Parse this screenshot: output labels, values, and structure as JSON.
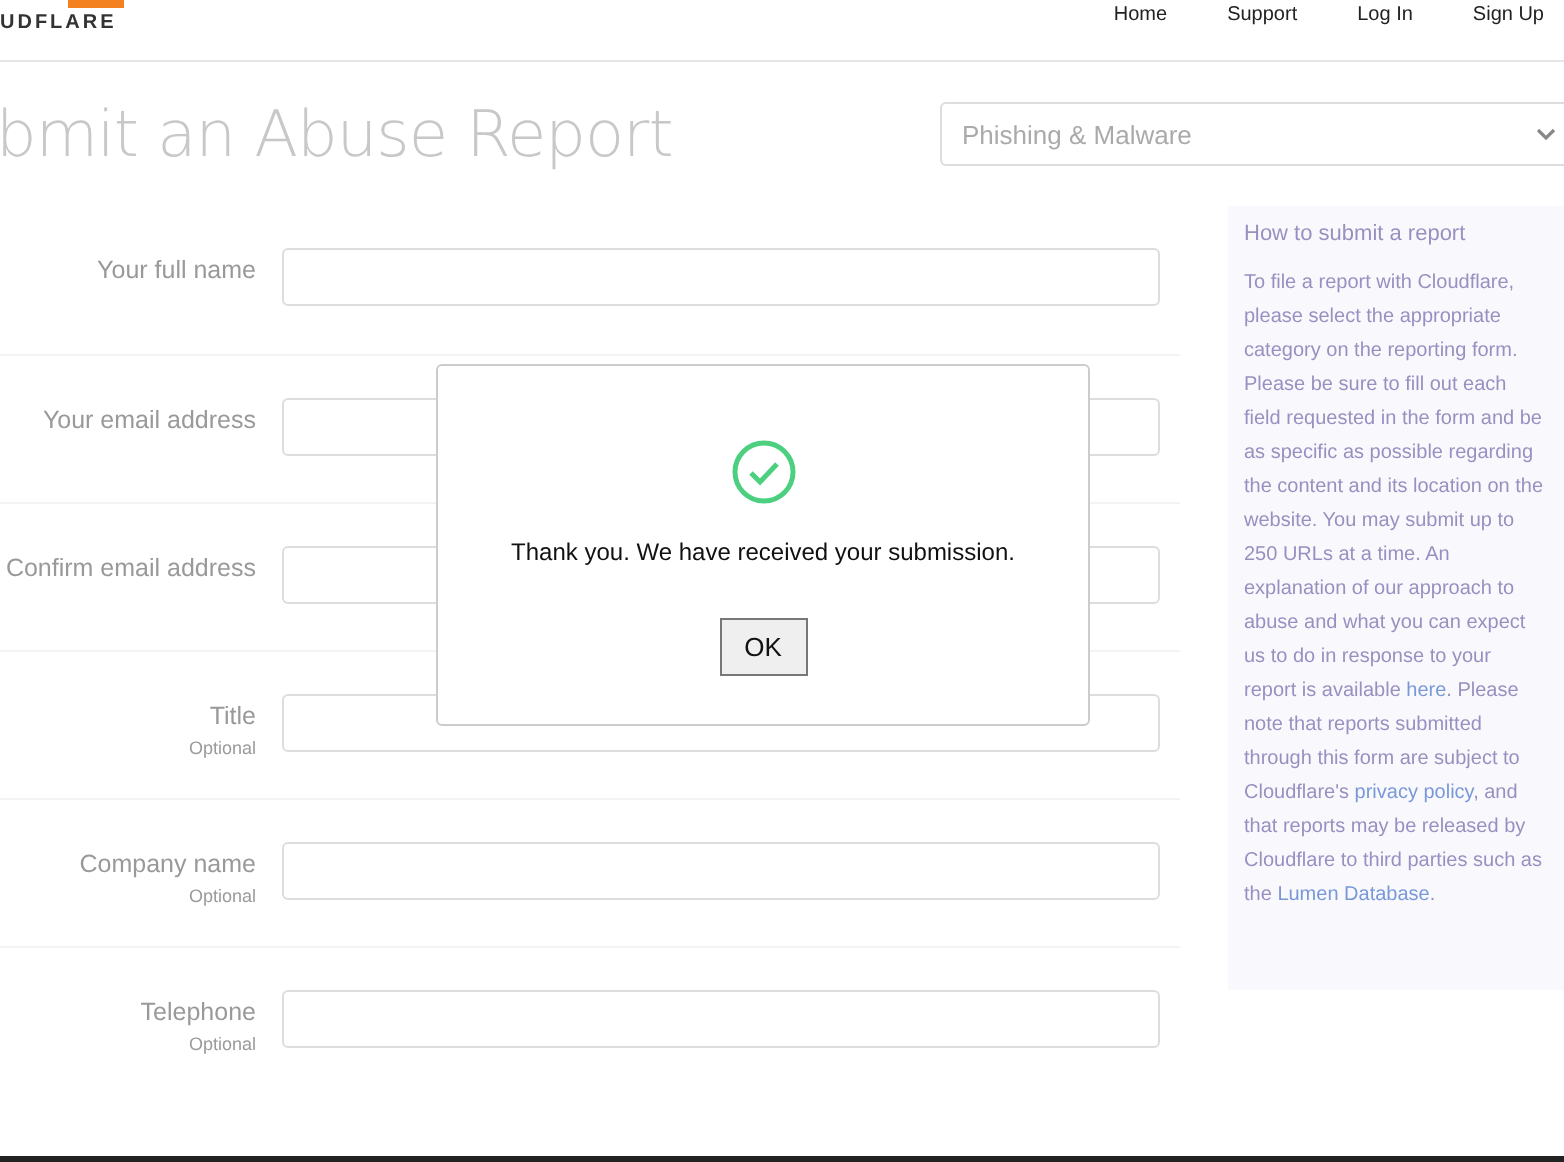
{
  "header": {
    "logo": "UDFLARE",
    "nav": [
      "Home",
      "Support",
      "Log In",
      "Sign Up"
    ]
  },
  "page_title": "bmit an Abuse Report",
  "category_select": {
    "value": "Phishing & Malware"
  },
  "form": {
    "fields": [
      {
        "label": "Your full name"
      },
      {
        "label": "Your email address"
      },
      {
        "label": "Confirm email address"
      },
      {
        "label": "Title",
        "note": "Optional"
      },
      {
        "label": "Company name",
        "note": "Optional"
      },
      {
        "label": "Telephone",
        "note": "Optional"
      }
    ]
  },
  "sidebar": {
    "heading": "How to submit a report",
    "paragraph": [
      {
        "kind": "text",
        "text": "To file a report with Cloudflare, please select the appropriate category on the reporting form. Please be sure to fill out each field requested in the form and be as specific as possible regarding the content and its location on the website. You may submit up to 250 URLs at a time. An explanation of our approach to abuse and what you can expect us to do in response to your report is available "
      },
      {
        "kind": "link",
        "text": "here"
      },
      {
        "kind": "text",
        "text": ". Please note that reports submitted through this form are subject to Cloudflare's "
      },
      {
        "kind": "link",
        "text": "privacy policy"
      },
      {
        "kind": "text",
        "text": ", and that reports may be released by Cloudflare to third parties such as the "
      },
      {
        "kind": "link",
        "text": "Lumen Database"
      },
      {
        "kind": "text",
        "text": "."
      }
    ]
  },
  "dialog": {
    "message": "Thank you. We have received your submission.",
    "button": "OK"
  }
}
